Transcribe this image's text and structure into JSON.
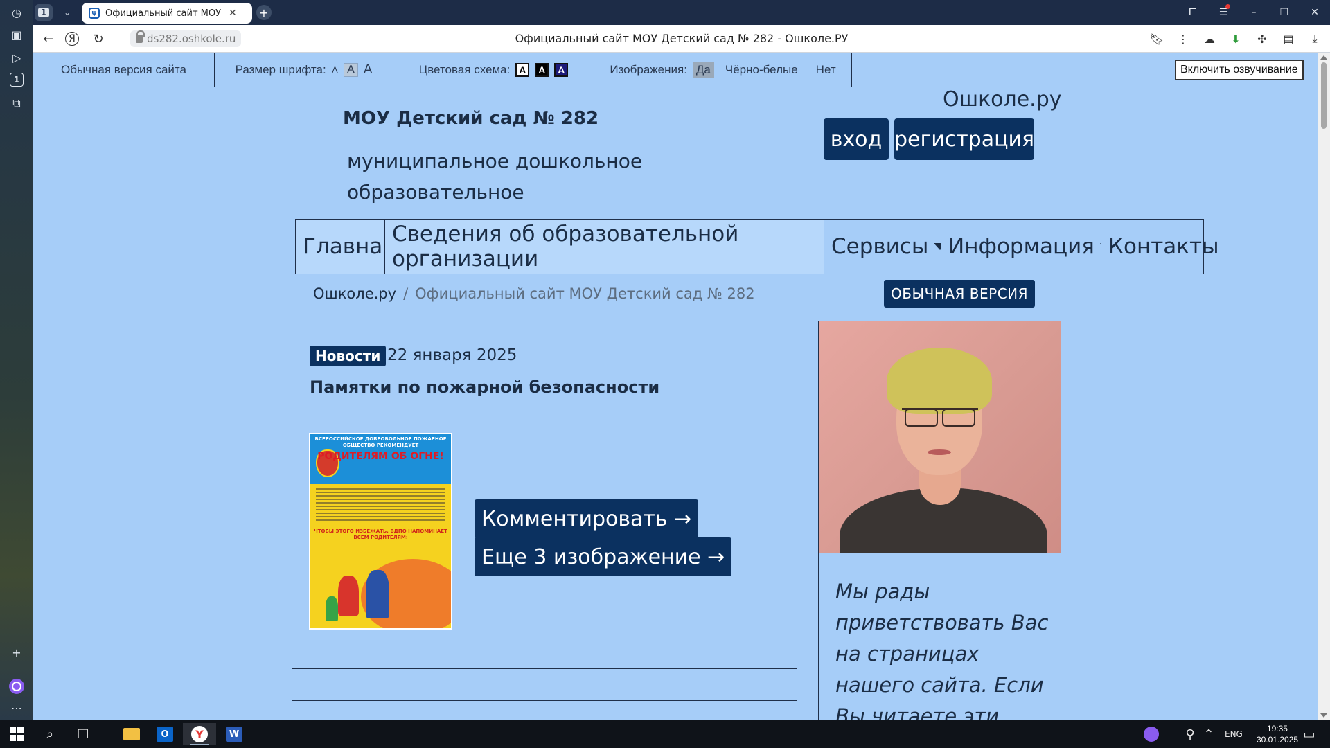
{
  "browser": {
    "tab_count": "1",
    "tab_title": "Официальный сайт МОУ",
    "url": "ds282.oshkole.ru",
    "page_title": "Официальный сайт МОУ Детский сад № 282 - Ошколе.РУ"
  },
  "accessibility": {
    "normal_version": "Обычная версия сайта",
    "font_size_label": "Размер шрифта:",
    "font_options": [
      "A",
      "A",
      "A"
    ],
    "color_scheme_label": "Цветовая схема:",
    "color_options": [
      "A",
      "A",
      "A"
    ],
    "images_label": "Изображения:",
    "images_yes": "Да",
    "images_bw": "Чёрно-белые",
    "images_no": "Нет",
    "speech_button": "Включить озвучивание"
  },
  "header": {
    "org_name": "МОУ Детский сад № 282",
    "org_type": "муниципальное дошкольное образовательное учреждение",
    "brand": "Ошколе.ру",
    "login": "вход",
    "register": "регистрация"
  },
  "nav": {
    "home": "Главная",
    "about": "Сведения об образовательной организации",
    "services": "Сервисы",
    "info": "Информация",
    "contacts": "Контакты"
  },
  "breadcrumb": {
    "home": "Ошколе.ру",
    "separator": "/",
    "current": "Официальный сайт МОУ Детский сад № 282"
  },
  "version_button": "ОБЫЧНАЯ ВЕРСИЯ",
  "news": {
    "tag": "Новости",
    "date": "22 января 2025",
    "title": "Памятки по пожарной безопасности",
    "comment_button": "Комментировать →",
    "more_images_button": "Еще 3 изображение →",
    "poster": {
      "line1": "ВСЕРОССИЙСКОЕ ДОБРОВОЛЬНОЕ ПОЖАРНОЕ ОБЩЕСТВО РЕКОМЕНДУЕТ",
      "line2": "РОДИТЕЛЯМ ОБ ОГНЕ!",
      "line3": "ЧТОБЫ ЭТОГО ИЗБЕЖАТЬ, ВДПО НАПОМИНАЕТ ВСЕМ РОДИТЕЛЯМ:"
    }
  },
  "director": {
    "greeting": "Мы рады приветствовать Вас на страницах нашего сайта. Если Вы читаете эти"
  },
  "taskbar": {
    "lang": "ENG",
    "time": "19:35",
    "date": "30.01.2025"
  },
  "colors": {
    "page_bg": "#a6cdf8",
    "accent": "#0b3160",
    "text": "#1b2d45"
  }
}
